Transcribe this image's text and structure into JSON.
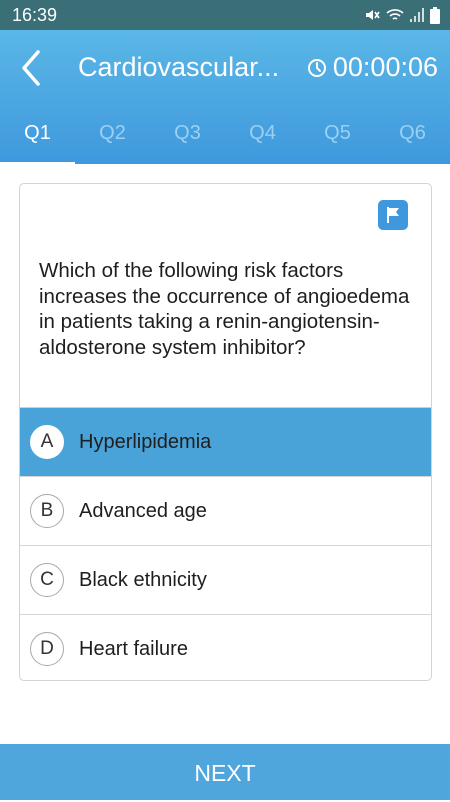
{
  "status_bar": {
    "time": "16:39"
  },
  "header": {
    "title": "Cardiovascular...",
    "timer": "00:00:06",
    "tabs": [
      {
        "label": "Q1",
        "active": true
      },
      {
        "label": "Q2",
        "active": false
      },
      {
        "label": "Q3",
        "active": false
      },
      {
        "label": "Q4",
        "active": false
      },
      {
        "label": "Q5",
        "active": false
      },
      {
        "label": "Q6",
        "active": false
      }
    ]
  },
  "question": {
    "text": "Which of the following risk factors increases the occurrence of angioedema in patients taking a renin-angiotensin-aldosterone system inhibitor?",
    "options": [
      {
        "letter": "A",
        "text": "Hyperlipidemia",
        "selected": true
      },
      {
        "letter": "B",
        "text": "Advanced age",
        "selected": false
      },
      {
        "letter": "C",
        "text": "Black ethnicity",
        "selected": false
      },
      {
        "letter": "D",
        "text": "Heart failure",
        "selected": false
      }
    ]
  },
  "footer": {
    "next_label": "NEXT"
  },
  "colors": {
    "status_bar": "#3a6f78",
    "header_top": "#5ab7e6",
    "header_bottom": "#3f98dd",
    "selected_option": "#4aa3d8",
    "next_button": "#4ea6dc"
  },
  "icons": [
    "mute-icon",
    "wifi-icon",
    "signal-icon",
    "battery-icon",
    "back-arrow-icon",
    "clock-icon",
    "flag-icon"
  ]
}
